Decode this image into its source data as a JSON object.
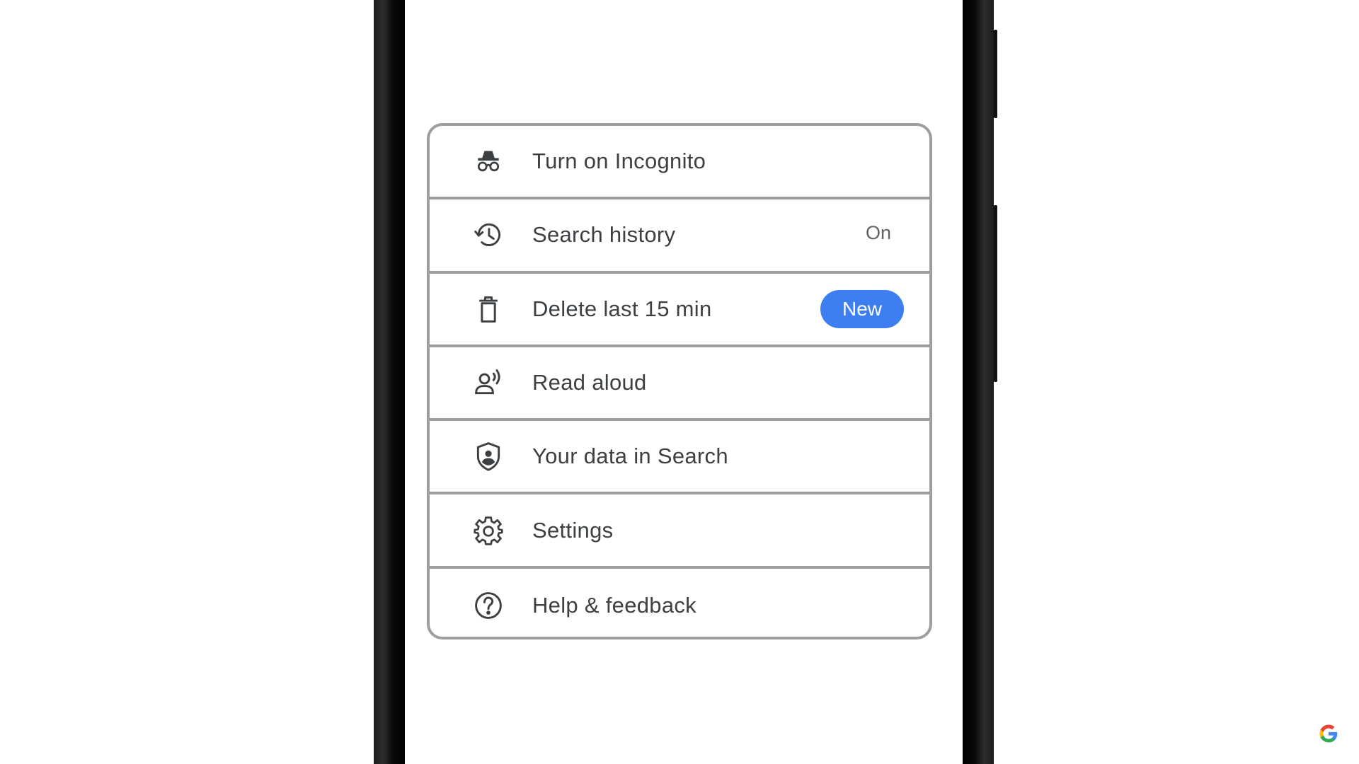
{
  "menu": {
    "items": [
      {
        "label": "Turn on Incognito",
        "icon": "incognito-icon"
      },
      {
        "label": "Search history",
        "icon": "history-icon",
        "status": "On"
      },
      {
        "label": "Delete last 15 min",
        "icon": "trash-icon",
        "badge": "New"
      },
      {
        "label": "Read aloud",
        "icon": "read-aloud-icon"
      },
      {
        "label": "Your data in Search",
        "icon": "shield-person-icon"
      },
      {
        "label": "Settings",
        "icon": "gear-icon"
      },
      {
        "label": "Help & feedback",
        "icon": "help-icon"
      }
    ]
  },
  "colors": {
    "badge": "#3d7ff0",
    "text": "#3c4043",
    "divider": "#9e9e9e"
  },
  "watermark": {
    "icon": "google-g-logo"
  }
}
